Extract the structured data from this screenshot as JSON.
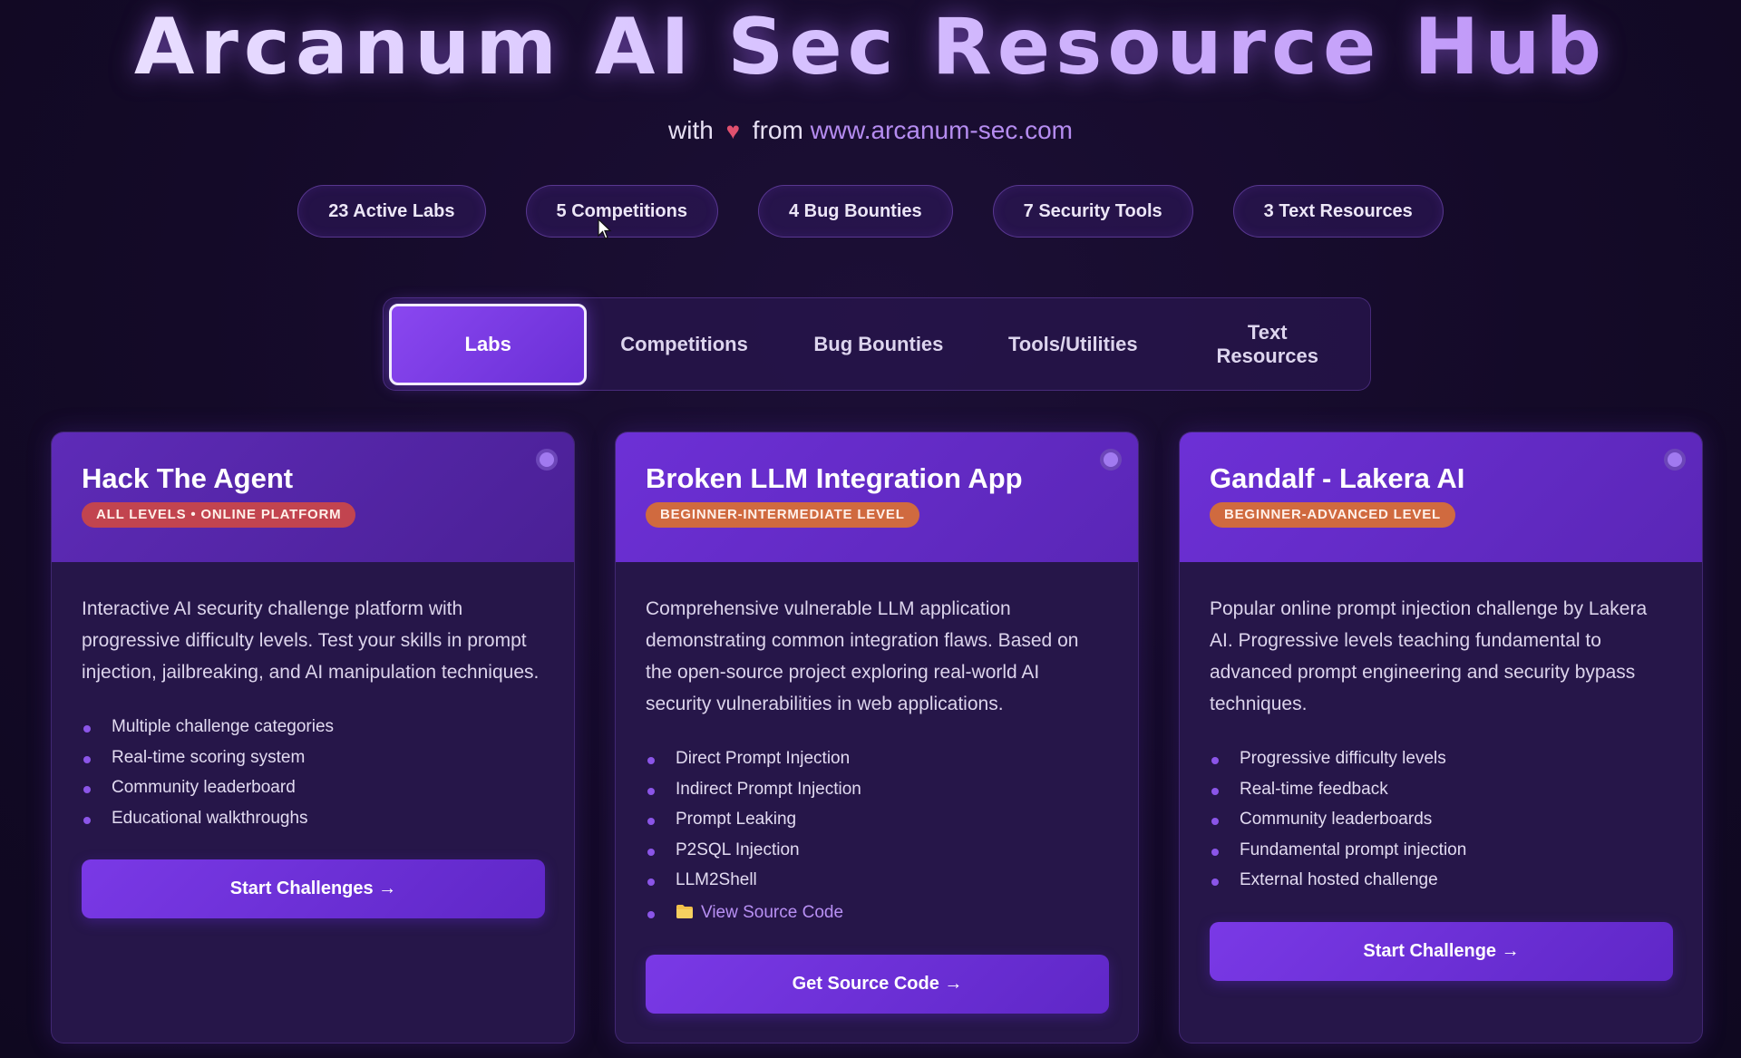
{
  "header": {
    "title": "Arcanum AI Sec Resource Hub",
    "subtitle_prefix": "with",
    "heart": "♥",
    "subtitle_mid": "from",
    "link": "www.arcanum-sec.com"
  },
  "stats": [
    "23 Active Labs",
    "5 Competitions",
    "4 Bug Bounties",
    "7 Security Tools",
    "3 Text Resources"
  ],
  "tabs": {
    "active": "Labs",
    "items": [
      "Labs",
      "Competitions",
      "Bug Bounties",
      "Tools/Utilities",
      "Text Resources"
    ]
  },
  "cards": [
    {
      "title": "Hack The Agent",
      "badge": "ALL LEVELS • ONLINE PLATFORM",
      "description": "Interactive AI security challenge platform with progressive difficulty levels. Test your skills in prompt injection, jailbreaking, and AI manipulation techniques.",
      "features": [
        "Multiple challenge categories",
        "Real-time scoring system",
        "Community leaderboard",
        "Educational walkthroughs"
      ],
      "button": "Start Challenges →"
    },
    {
      "title": "Broken LLM Integration App",
      "badge": "BEGINNER-INTERMEDIATE LEVEL",
      "description": "Comprehensive vulnerable LLM application demonstrating common integration flaws. Based on the open-source project exploring real-world AI security vulnerabilities in web applications.",
      "features": [
        "Direct Prompt Injection",
        "Indirect Prompt Injection",
        "Prompt Leaking",
        "P2SQL Injection",
        "LLM2Shell"
      ],
      "source_link": "View Source Code",
      "button": "Get Source Code →"
    },
    {
      "title": "Gandalf - Lakera AI",
      "badge": "BEGINNER-ADVANCED LEVEL",
      "description": "Popular online prompt injection challenge by Lakera AI. Progressive levels teaching fundamental to advanced prompt engineering and security bypass techniques.",
      "features": [
        "Progressive difficulty levels",
        "Real-time feedback",
        "Community leaderboards",
        "Fundamental prompt injection",
        "External hosted challenge"
      ],
      "button": "Start Challenge →"
    }
  ],
  "colors": {
    "background": "#140a28",
    "accent": "#7a39e6",
    "badge_red": "#c2444f",
    "badge_orange": "#d06a3f",
    "link": "#b58cf0"
  }
}
